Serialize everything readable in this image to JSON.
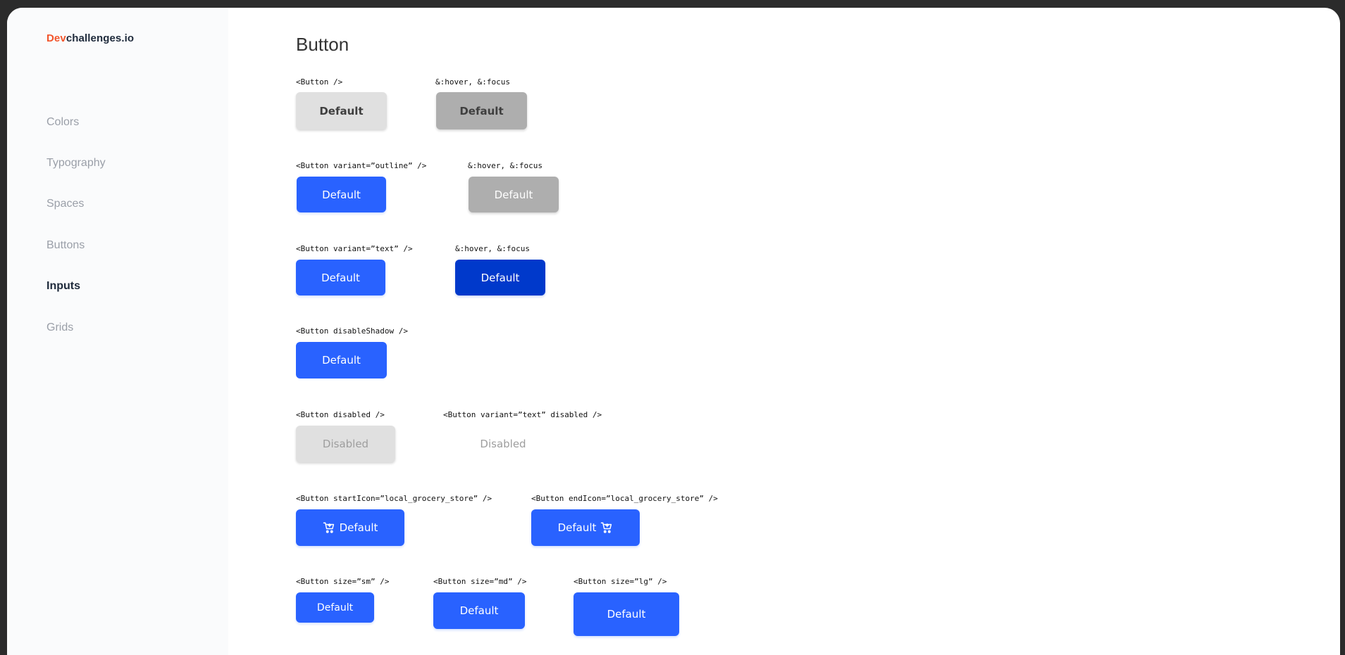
{
  "logo": {
    "prefix": "Dev",
    "suffix": "challenges.io"
  },
  "nav": {
    "items": [
      {
        "label": "Colors"
      },
      {
        "label": "Typography"
      },
      {
        "label": "Spaces"
      },
      {
        "label": "Buttons"
      },
      {
        "label": "Inputs"
      },
      {
        "label": "Grids"
      }
    ],
    "active": "Inputs"
  },
  "page": {
    "title": "Button"
  },
  "sections": {
    "default": {
      "code": "<Button />",
      "hover_code": "&:hover, &:focus",
      "label": "Default",
      "hover_label": "Default"
    },
    "outline": {
      "code": "<Button variant=”outline” />",
      "hover_code": "&:hover, &:focus",
      "label": "Default",
      "hover_label": "Default"
    },
    "text": {
      "code": "<Button variant=”text” />",
      "hover_code": "&:hover, &:focus",
      "label": "Default",
      "hover_label": "Default"
    },
    "disable_shadow": {
      "code": "<Button disableShadow />",
      "label": "Default"
    },
    "disabled": {
      "code": "<Button disabled />",
      "text_code": "<Button variant=”text” disabled />",
      "label": "Disabled",
      "text_label": "Disabled"
    },
    "icons": {
      "start_code": "<Button startIcon=”local_grocery_store” />",
      "end_code": "<Button endIcon=”local_grocery_store” />",
      "start_label": "Default",
      "end_label": "Default",
      "icon_name": "local-grocery-store-icon"
    },
    "sizes": {
      "sm_code": "<Button size=”sm” />",
      "md_code": "<Button size=”md” />",
      "lg_code": "<Button size=”lg” />",
      "sm_label": "Default",
      "md_label": "Default",
      "lg_label": "Default"
    }
  },
  "colors": {
    "primary": "#2962FF",
    "primary_dark": "#0039CB",
    "default": "#E0E0E0",
    "default_hover": "#AEAEAE",
    "brand_accent": "#F2552C",
    "text_dark": "#1E2A3B"
  }
}
